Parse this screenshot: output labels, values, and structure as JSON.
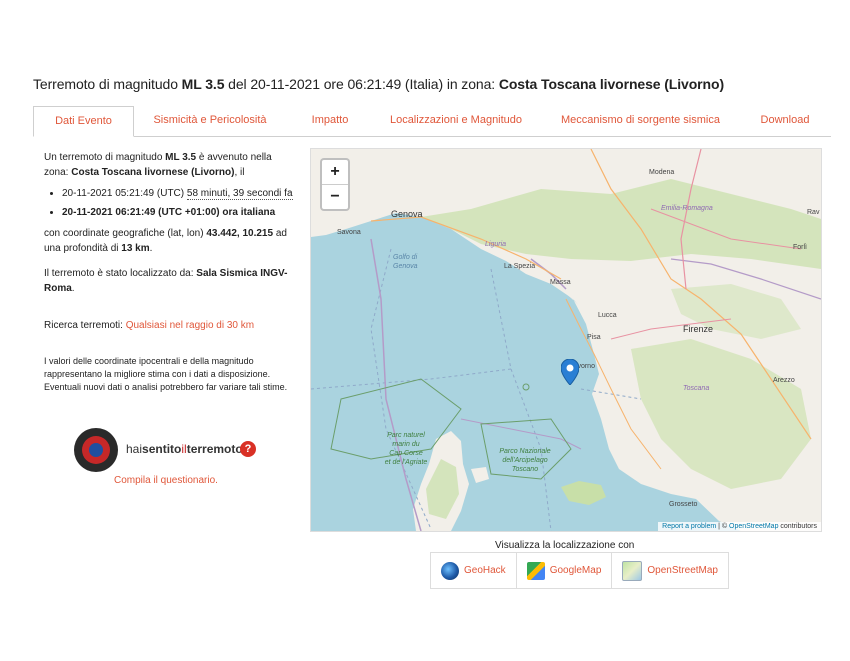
{
  "title": {
    "prefix": "Terremoto di magnitudo ",
    "magnitude": "ML 3.5",
    "middle": " del 20-11-2021 ore 06:21:49 (Italia) in zona: ",
    "zone": "Costa Toscana livornese (Livorno)"
  },
  "tabs": [
    {
      "label": "Dati Evento",
      "active": true
    },
    {
      "label": "Sismicità e Pericolosità"
    },
    {
      "label": "Impatto"
    },
    {
      "label": "Localizzazioni e Magnitudo"
    },
    {
      "label": "Meccanismo di sorgente sismica"
    },
    {
      "label": "Download"
    }
  ],
  "event": {
    "intro1": "Un terremoto di magnitudo ",
    "magnitude": "ML 3.5",
    "intro2": " è avvenuto nella zona: ",
    "zone": "Costa Toscana livornese (Livorno)",
    "intro3": ", il",
    "utc_time": "20-11-2021 05:21:49 (UTC) ",
    "ago": "58 minuti, 39 secondi fa",
    "local_time": "20-11-2021 06:21:49 (UTC +01:00) ora italiana",
    "coords_prefix": "con coordinate geografiche (lat, lon) ",
    "coords": "43.442, 10.215",
    "depth_prefix": " ad una profondità di ",
    "depth": "13 km",
    "dot": ".",
    "located_prefix": "Il terremoto è stato localizzato da: ",
    "located_by": "Sala Sismica INGV-Roma",
    "search_label": "Ricerca terremoti: ",
    "search_link": "Qualsiasi nel raggio di 30 km",
    "disclaimer": "I valori delle coordinate ipocentrali e della magnitudo rappresentano la migliore stima con i dati a disposizione. Eventuali nuovi dati o analisi potrebbero far variare tali stime."
  },
  "hst": {
    "hai": "hai",
    "sentito": "sentito",
    "il": "il",
    "terremoto": "terremoto",
    "q": "?",
    "compila": "Compila il questionario."
  },
  "map": {
    "zoom_in": "+",
    "zoom_out": "−",
    "places": {
      "genova": "Genova",
      "savona": "Savona",
      "modena": "Modena",
      "emilia": "Emilia-Romagna",
      "golfo": "Golfo di Genova",
      "liguria": "Liguria",
      "laspezia": "La Spezia",
      "massa": "Massa",
      "lucca": "Lucca",
      "pisa": "Pisa",
      "firenze": "Firenze",
      "livorno": "Livorno",
      "toscana": "Toscana",
      "arezzo": "Arezzo",
      "grosseto": "Grosseto",
      "forli": "Forlì",
      "rav": "Rav",
      "parc1": "Parc naturel",
      "parc2": "marin du",
      "parc3": "Cap Corse",
      "parc4": "et de l'Agriate",
      "parco1": "Parco Nazionale",
      "parco2": "dell'Arcipelago",
      "parco3": "Toscano"
    },
    "attrib_link": "Report a problem",
    "attrib_sep": " | © ",
    "attrib_osm": "OpenStreetMap",
    "attrib_end": " contributors"
  },
  "viz": {
    "label": "Visualizza la localizzazione con",
    "buttons": [
      "GeoHack",
      "GoogleMap",
      "OpenStreetMap"
    ]
  },
  "colors": {
    "accent": "#e0573a",
    "sea": "#aad3df",
    "land": "#f2efe9",
    "green": "#c8dfa8",
    "marker": "#2a7fd4"
  }
}
